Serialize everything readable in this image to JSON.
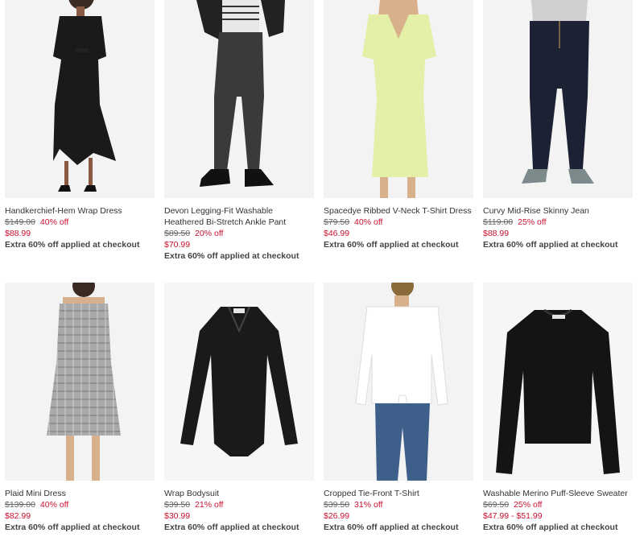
{
  "products": [
    {
      "name": "Handkerchief-Hem Wrap Dress",
      "original_price": "$149.00",
      "discount": "40% off",
      "sale_price": "$88.99",
      "promo": "Extra 60% off applied at checkout"
    },
    {
      "name": "Devon Legging-Fit Washable Heathered Bi-Stretch Ankle Pant",
      "original_price": "$89.50",
      "discount": "20% off",
      "sale_price": "$70.99",
      "promo": "Extra 60% off applied at checkout"
    },
    {
      "name": "Spacedye Ribbed V-Neck T-Shirt Dress",
      "original_price": "$79.50",
      "discount": "40% off",
      "sale_price": "$46.99",
      "promo": "Extra 60% off applied at checkout"
    },
    {
      "name": "Curvy Mid-Rise Skinny Jean",
      "original_price": "$119.00",
      "discount": "25% off",
      "sale_price": "$88.99",
      "promo": "Extra 60% off applied at checkout"
    },
    {
      "name": "Plaid Mini Dress",
      "original_price": "$139.00",
      "discount": "40% off",
      "sale_price": "$82.99",
      "promo": "Extra 60% off applied at checkout"
    },
    {
      "name": "Wrap Bodysuit",
      "original_price": "$39.50",
      "discount": "21% off",
      "sale_price": "$30.99",
      "promo": "Extra 60% off applied at checkout"
    },
    {
      "name": "Cropped Tie-Front T-Shirt",
      "original_price": "$39.50",
      "discount": "31% off",
      "sale_price": "$26.99",
      "promo": "Extra 60% off applied at checkout"
    },
    {
      "name": "Washable Merino Puff-Sleeve Sweater",
      "original_price": "$69.50",
      "discount": "25% off",
      "sale_price": "$47.99 - $51.99",
      "promo": "Extra 60% off applied at checkout"
    }
  ]
}
